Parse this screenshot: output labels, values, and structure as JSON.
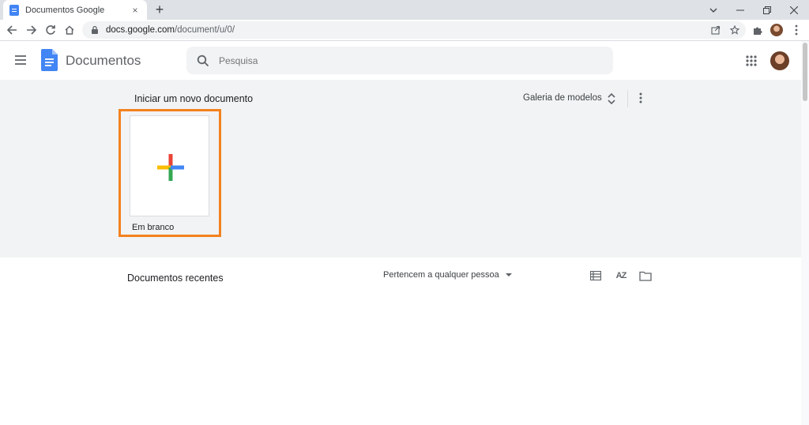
{
  "browser": {
    "tab_title": "Documentos Google",
    "tab_close": "×",
    "new_tab": "+",
    "url_host": "docs.google.com",
    "url_path": "/document/u/0/"
  },
  "header": {
    "app_title": "Documentos",
    "search_placeholder": "Pesquisa"
  },
  "gallery": {
    "title": "Iniciar um novo documento",
    "gallery_link": "Galeria de modelos",
    "templates": [
      {
        "label": "Em branco"
      }
    ]
  },
  "recent": {
    "title": "Documentos recentes",
    "owner_filter": "Pertencem a qualquer pessoa",
    "sort_label": "AZ"
  },
  "colors": {
    "accent_blue": "#4285f4",
    "highlight_orange": "#f4811f",
    "plus_red": "#ea4335",
    "plus_yellow": "#fbbc04",
    "plus_green": "#34a853",
    "plus_blue": "#4285f4"
  },
  "icons": [
    "docs-favicon-icon",
    "close-icon",
    "plus-icon",
    "minimize-icon",
    "chevron-down-icon",
    "restore-icon",
    "back-arrow-icon",
    "forward-arrow-icon",
    "reload-icon",
    "home-icon",
    "lock-icon",
    "share-icon",
    "star-icon",
    "extensions-icon",
    "kebab-menu-icon",
    "hamburger-icon",
    "docs-logo-icon",
    "search-icon",
    "apps-grid-icon",
    "unfold-icon",
    "list-view-icon",
    "sort-az-icon",
    "folder-icon"
  ]
}
